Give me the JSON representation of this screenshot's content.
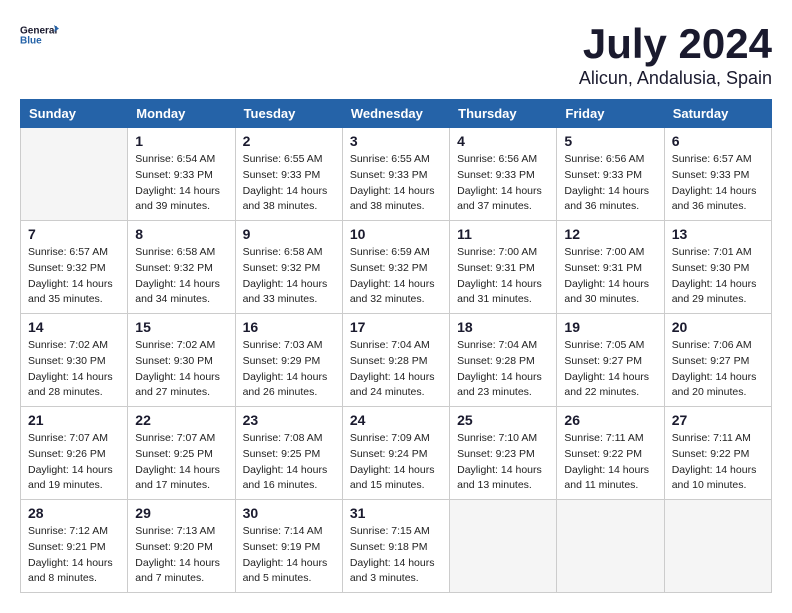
{
  "header": {
    "logo_general": "General",
    "logo_blue": "Blue",
    "month": "July 2024",
    "location": "Alicun, Andalusia, Spain"
  },
  "weekdays": [
    "Sunday",
    "Monday",
    "Tuesday",
    "Wednesday",
    "Thursday",
    "Friday",
    "Saturday"
  ],
  "weeks": [
    [
      {
        "day": "",
        "sunrise": "",
        "sunset": "",
        "daylight": ""
      },
      {
        "day": "1",
        "sunrise": "Sunrise: 6:54 AM",
        "sunset": "Sunset: 9:33 PM",
        "daylight": "Daylight: 14 hours and 39 minutes."
      },
      {
        "day": "2",
        "sunrise": "Sunrise: 6:55 AM",
        "sunset": "Sunset: 9:33 PM",
        "daylight": "Daylight: 14 hours and 38 minutes."
      },
      {
        "day": "3",
        "sunrise": "Sunrise: 6:55 AM",
        "sunset": "Sunset: 9:33 PM",
        "daylight": "Daylight: 14 hours and 38 minutes."
      },
      {
        "day": "4",
        "sunrise": "Sunrise: 6:56 AM",
        "sunset": "Sunset: 9:33 PM",
        "daylight": "Daylight: 14 hours and 37 minutes."
      },
      {
        "day": "5",
        "sunrise": "Sunrise: 6:56 AM",
        "sunset": "Sunset: 9:33 PM",
        "daylight": "Daylight: 14 hours and 36 minutes."
      },
      {
        "day": "6",
        "sunrise": "Sunrise: 6:57 AM",
        "sunset": "Sunset: 9:33 PM",
        "daylight": "Daylight: 14 hours and 36 minutes."
      }
    ],
    [
      {
        "day": "7",
        "sunrise": "Sunrise: 6:57 AM",
        "sunset": "Sunset: 9:32 PM",
        "daylight": "Daylight: 14 hours and 35 minutes."
      },
      {
        "day": "8",
        "sunrise": "Sunrise: 6:58 AM",
        "sunset": "Sunset: 9:32 PM",
        "daylight": "Daylight: 14 hours and 34 minutes."
      },
      {
        "day": "9",
        "sunrise": "Sunrise: 6:58 AM",
        "sunset": "Sunset: 9:32 PM",
        "daylight": "Daylight: 14 hours and 33 minutes."
      },
      {
        "day": "10",
        "sunrise": "Sunrise: 6:59 AM",
        "sunset": "Sunset: 9:32 PM",
        "daylight": "Daylight: 14 hours and 32 minutes."
      },
      {
        "day": "11",
        "sunrise": "Sunrise: 7:00 AM",
        "sunset": "Sunset: 9:31 PM",
        "daylight": "Daylight: 14 hours and 31 minutes."
      },
      {
        "day": "12",
        "sunrise": "Sunrise: 7:00 AM",
        "sunset": "Sunset: 9:31 PM",
        "daylight": "Daylight: 14 hours and 30 minutes."
      },
      {
        "day": "13",
        "sunrise": "Sunrise: 7:01 AM",
        "sunset": "Sunset: 9:30 PM",
        "daylight": "Daylight: 14 hours and 29 minutes."
      }
    ],
    [
      {
        "day": "14",
        "sunrise": "Sunrise: 7:02 AM",
        "sunset": "Sunset: 9:30 PM",
        "daylight": "Daylight: 14 hours and 28 minutes."
      },
      {
        "day": "15",
        "sunrise": "Sunrise: 7:02 AM",
        "sunset": "Sunset: 9:30 PM",
        "daylight": "Daylight: 14 hours and 27 minutes."
      },
      {
        "day": "16",
        "sunrise": "Sunrise: 7:03 AM",
        "sunset": "Sunset: 9:29 PM",
        "daylight": "Daylight: 14 hours and 26 minutes."
      },
      {
        "day": "17",
        "sunrise": "Sunrise: 7:04 AM",
        "sunset": "Sunset: 9:28 PM",
        "daylight": "Daylight: 14 hours and 24 minutes."
      },
      {
        "day": "18",
        "sunrise": "Sunrise: 7:04 AM",
        "sunset": "Sunset: 9:28 PM",
        "daylight": "Daylight: 14 hours and 23 minutes."
      },
      {
        "day": "19",
        "sunrise": "Sunrise: 7:05 AM",
        "sunset": "Sunset: 9:27 PM",
        "daylight": "Daylight: 14 hours and 22 minutes."
      },
      {
        "day": "20",
        "sunrise": "Sunrise: 7:06 AM",
        "sunset": "Sunset: 9:27 PM",
        "daylight": "Daylight: 14 hours and 20 minutes."
      }
    ],
    [
      {
        "day": "21",
        "sunrise": "Sunrise: 7:07 AM",
        "sunset": "Sunset: 9:26 PM",
        "daylight": "Daylight: 14 hours and 19 minutes."
      },
      {
        "day": "22",
        "sunrise": "Sunrise: 7:07 AM",
        "sunset": "Sunset: 9:25 PM",
        "daylight": "Daylight: 14 hours and 17 minutes."
      },
      {
        "day": "23",
        "sunrise": "Sunrise: 7:08 AM",
        "sunset": "Sunset: 9:25 PM",
        "daylight": "Daylight: 14 hours and 16 minutes."
      },
      {
        "day": "24",
        "sunrise": "Sunrise: 7:09 AM",
        "sunset": "Sunset: 9:24 PM",
        "daylight": "Daylight: 14 hours and 15 minutes."
      },
      {
        "day": "25",
        "sunrise": "Sunrise: 7:10 AM",
        "sunset": "Sunset: 9:23 PM",
        "daylight": "Daylight: 14 hours and 13 minutes."
      },
      {
        "day": "26",
        "sunrise": "Sunrise: 7:11 AM",
        "sunset": "Sunset: 9:22 PM",
        "daylight": "Daylight: 14 hours and 11 minutes."
      },
      {
        "day": "27",
        "sunrise": "Sunrise: 7:11 AM",
        "sunset": "Sunset: 9:22 PM",
        "daylight": "Daylight: 14 hours and 10 minutes."
      }
    ],
    [
      {
        "day": "28",
        "sunrise": "Sunrise: 7:12 AM",
        "sunset": "Sunset: 9:21 PM",
        "daylight": "Daylight: 14 hours and 8 minutes."
      },
      {
        "day": "29",
        "sunrise": "Sunrise: 7:13 AM",
        "sunset": "Sunset: 9:20 PM",
        "daylight": "Daylight: 14 hours and 7 minutes."
      },
      {
        "day": "30",
        "sunrise": "Sunrise: 7:14 AM",
        "sunset": "Sunset: 9:19 PM",
        "daylight": "Daylight: 14 hours and 5 minutes."
      },
      {
        "day": "31",
        "sunrise": "Sunrise: 7:15 AM",
        "sunset": "Sunset: 9:18 PM",
        "daylight": "Daylight: 14 hours and 3 minutes."
      },
      {
        "day": "",
        "sunrise": "",
        "sunset": "",
        "daylight": ""
      },
      {
        "day": "",
        "sunrise": "",
        "sunset": "",
        "daylight": ""
      },
      {
        "day": "",
        "sunrise": "",
        "sunset": "",
        "daylight": ""
      }
    ]
  ]
}
